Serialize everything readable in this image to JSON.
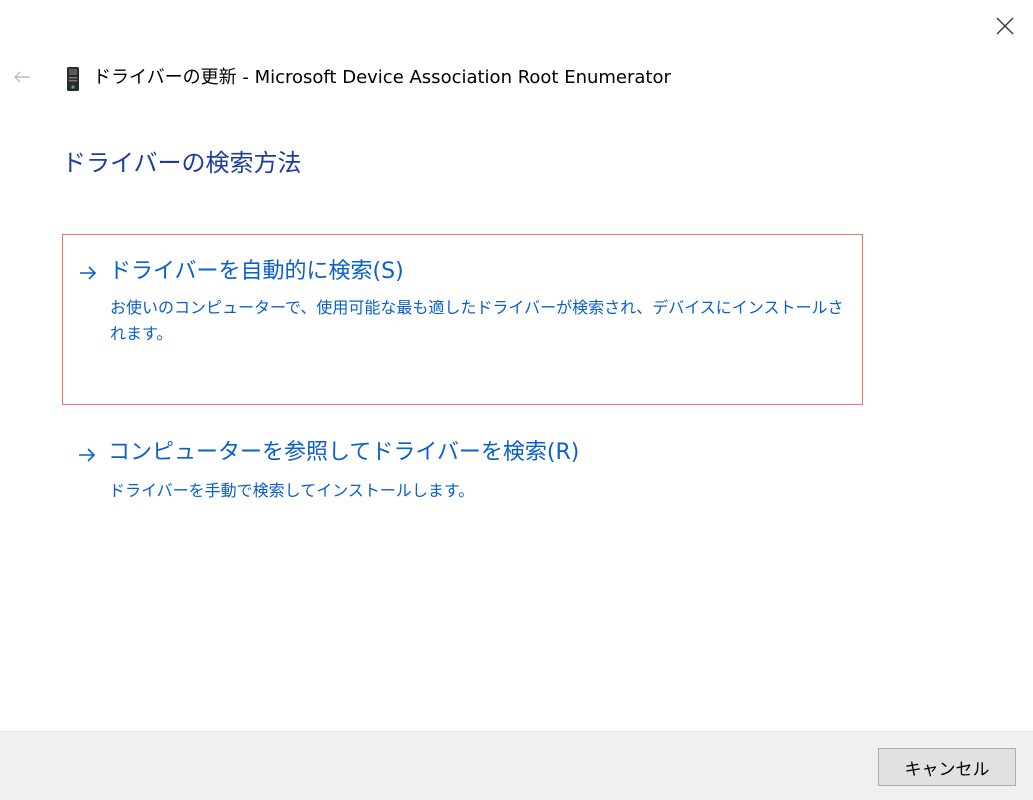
{
  "window": {
    "title": "ドライバーの更新 - Microsoft Device Association Root Enumerator",
    "close_icon": "close-icon",
    "back_icon": "back-arrow-icon",
    "device_icon": "device-icon"
  },
  "page": {
    "heading": "ドライバーの検索方法"
  },
  "options": [
    {
      "icon": "arrow-right-icon",
      "title": "ドライバーを自動的に検索(S)",
      "description": "お使いのコンピューターで、使用可能な最も適したドライバーが検索され、デバイスにインストールされます。"
    },
    {
      "icon": "arrow-right-icon",
      "title": "コンピューターを参照してドライバーを検索(R)",
      "description": "ドライバーを手動で検索してインストールします。"
    }
  ],
  "footer": {
    "cancel_label": "キャンセル"
  },
  "colors": {
    "heading": "#1f3d9c",
    "link": "#0a5fcf",
    "highlight_border": "#e87474",
    "footer_bg": "#f0f0f0"
  }
}
